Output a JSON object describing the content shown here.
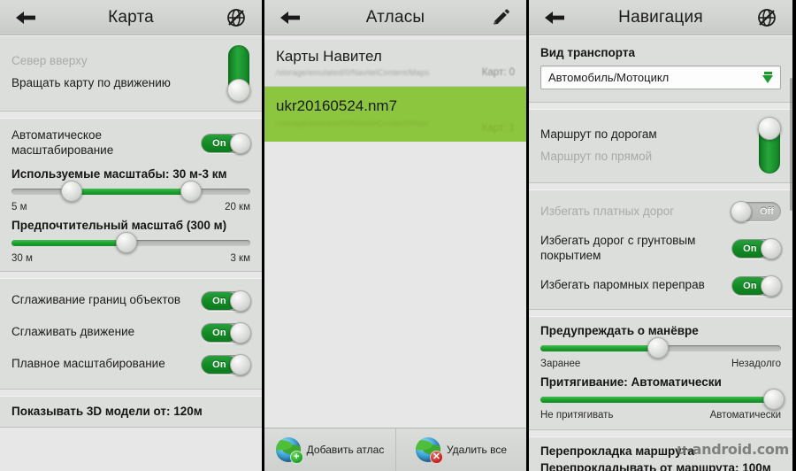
{
  "panels": [
    {
      "title": "Карта",
      "back_icon": "arrow-left-icon",
      "right_icon": "satellite-off-icon",
      "rotate_group": {
        "north_up_label": "Север вверху",
        "rotate_label": "Вращать карту по движению",
        "toggle_state": "rotate"
      },
      "autoscale": {
        "label": "Автоматическое\nмасштабирование",
        "label_line1": "Автоматическое",
        "label_line2": "масштабирование",
        "toggle": "On"
      },
      "used_scales": {
        "title": "Используемые масштабы: 30 м-3 км",
        "min_label": "5 м",
        "max_label": "20 км",
        "thumb_low_pct": 25,
        "thumb_high_pct": 75
      },
      "preferred_scale": {
        "title": "Предпочтительный масштаб (300 м)",
        "min_label": "30 м",
        "max_label": "3 км",
        "thumb_pct": 48
      },
      "switches": [
        {
          "label": "Сглаживание границ объектов",
          "state": "On"
        },
        {
          "label": "Сглаживать движение",
          "state": "On"
        },
        {
          "label": "Плавное масштабирование",
          "state": "On"
        }
      ],
      "models_3d": "Показывать 3D модели от: 120м"
    },
    {
      "title": "Атласы",
      "back_icon": "arrow-left-icon",
      "right_icon": "pencil-edit-icon",
      "items": [
        {
          "name": "Карты Навител",
          "path": "/storage/emulated/0/NavitelContent/Maps",
          "count": "Карт: 0",
          "selected": false
        },
        {
          "name": "ukr20160524.nm7",
          "path": "/storage/emulated/0/NavitelContent/Maps",
          "count": "Карт: 1",
          "selected": true
        }
      ],
      "bottom_buttons": [
        {
          "label": "Добавить атлас",
          "icon": "globe-add-icon",
          "badge": "+"
        },
        {
          "label": "Удалить все",
          "icon": "globe-delete-icon",
          "badge": "✕"
        }
      ]
    },
    {
      "title": "Навигация",
      "back_icon": "arrow-left-icon",
      "right_icon": "satellite-off-icon",
      "transport": {
        "label": "Вид транспорта",
        "value": "Автомобиль/Мотоцикл",
        "caret_icon": "chevron-down-icon"
      },
      "route_mode": {
        "roads_label": "Маршрут по дорогам",
        "straight_label": "Маршрут по прямой",
        "toggle_state": "roads"
      },
      "switches": [
        {
          "label": "Избегать платных дорог",
          "state": "Off",
          "dim": true
        },
        {
          "label": "Избегать дорог с грунтовым покрытием",
          "label_line1": "Избегать дорог с грунтовым",
          "label_line2": "покрытием",
          "state": "On",
          "dim": false
        },
        {
          "label": "Избегать паромных переправ",
          "state": "On",
          "dim": false
        }
      ],
      "maneuver": {
        "title": "Предупреждать о манёвре",
        "min_label": "Заранее",
        "max_label": "Незадолго",
        "thumb_pct": 49
      },
      "snap": {
        "title": "Притягивание: Автоматически",
        "min_label": "Не притягивать",
        "max_label": "Автоматически",
        "thumb_pct": 98
      },
      "reroute_title": "Перепрокладка маршрута",
      "reroute_sub": "Перепрокладывать от маршрута: 100м",
      "watermark": "u-android.com"
    }
  ],
  "colors": {
    "accent_green": "#1d9a2e",
    "selected_green": "#8cc63e",
    "panel_bg": "#dcdedb",
    "screen_bg": "#e7e7e7"
  }
}
